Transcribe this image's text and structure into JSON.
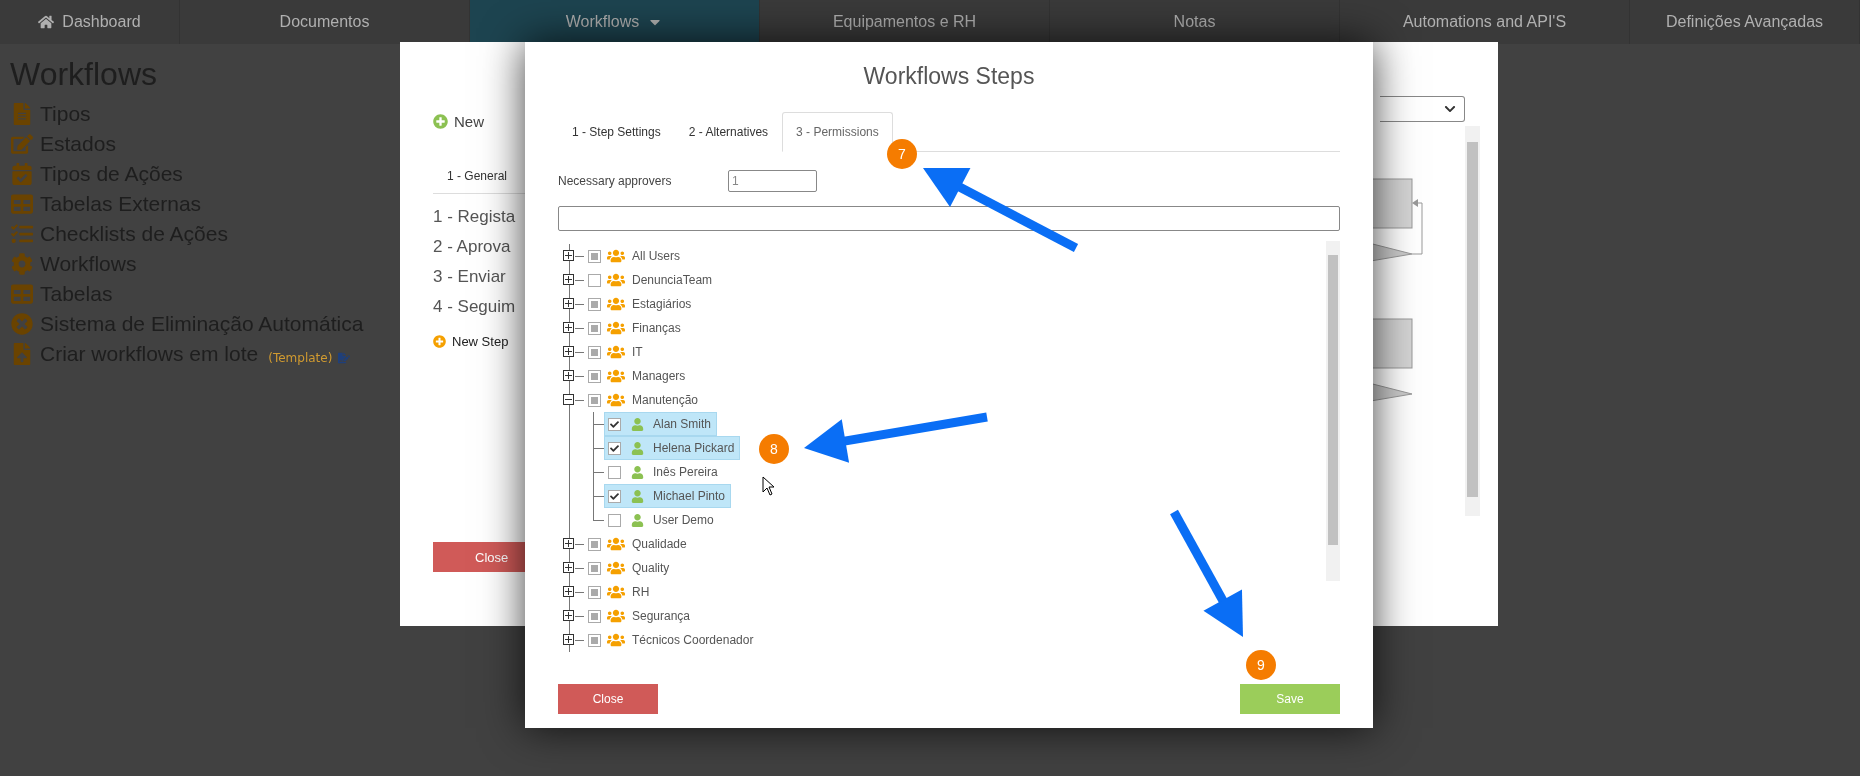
{
  "nav": {
    "items": [
      {
        "label": "Dashboard",
        "selected": false
      },
      {
        "label": "Documentos",
        "selected": false
      },
      {
        "label": "Workflows",
        "selected": true
      },
      {
        "label": "Equipamentos e RH",
        "selected": false
      },
      {
        "label": "Notas",
        "selected": false
      },
      {
        "label": "Automations and API'S",
        "selected": false
      },
      {
        "label": "Definições Avançadas",
        "selected": false
      }
    ]
  },
  "sidebar": {
    "title": "Workflows",
    "items": [
      {
        "label": "Tipos"
      },
      {
        "label": "Estados"
      },
      {
        "label": "Tipos de Ações"
      },
      {
        "label": "Tabelas Externas"
      },
      {
        "label": "Checklists de Ações"
      },
      {
        "label": "Workflows"
      },
      {
        "label": "Tabelas"
      },
      {
        "label": "Sistema de Eliminação Automática"
      },
      {
        "label": "Criar workflows em lote",
        "note": "(Template)"
      }
    ]
  },
  "back_dialog": {
    "new_button": "New",
    "tab": "1 - General",
    "steps": [
      "1 - Regista",
      "2 - Aprova",
      "3 - Enviar",
      "4 - Seguim"
    ],
    "new_step": "New Step",
    "close": "Close"
  },
  "dialog": {
    "title": "Workflows Steps",
    "tabs": [
      {
        "label": "1 - Step Settings",
        "selected": false
      },
      {
        "label": "2 - Alternatives",
        "selected": false
      },
      {
        "label": "3 - Permissions",
        "selected": true
      }
    ],
    "approvers_label": "Necessary approvers",
    "approvers_value": "1",
    "tree": [
      {
        "label": "All Users",
        "expanded": false,
        "checked": false,
        "partial": true
      },
      {
        "label": "DenunciaTeam",
        "expanded": false,
        "checked": false,
        "partial": false
      },
      {
        "label": "Estagiários",
        "expanded": false,
        "checked": false,
        "partial": true
      },
      {
        "label": "Finanças",
        "expanded": false,
        "checked": false,
        "partial": true
      },
      {
        "label": "IT",
        "expanded": false,
        "checked": false,
        "partial": true
      },
      {
        "label": "Managers",
        "expanded": false,
        "checked": false,
        "partial": true
      },
      {
        "label": "Manutenção",
        "expanded": true,
        "checked": false,
        "partial": true,
        "children": [
          {
            "label": "Alan Smith",
            "checked": true,
            "selected": true
          },
          {
            "label": "Helena Pickard",
            "checked": true,
            "selected": true
          },
          {
            "label": "Inês Pereira",
            "checked": false,
            "selected": false
          },
          {
            "label": "Michael Pinto",
            "checked": true,
            "selected": true
          },
          {
            "label": "User Demo",
            "checked": false,
            "selected": false
          }
        ]
      },
      {
        "label": "Qualidade",
        "expanded": false,
        "checked": false,
        "partial": true
      },
      {
        "label": "Quality",
        "expanded": false,
        "checked": false,
        "partial": true
      },
      {
        "label": "RH",
        "expanded": false,
        "checked": false,
        "partial": true
      },
      {
        "label": "Segurança",
        "expanded": false,
        "checked": false,
        "partial": true
      },
      {
        "label": "Técnicos Coordenador",
        "expanded": false,
        "checked": false,
        "partial": true
      }
    ],
    "close": "Close",
    "save": "Save"
  },
  "annotations": [
    {
      "label": "7"
    },
    {
      "label": "8"
    },
    {
      "label": "9"
    }
  ]
}
